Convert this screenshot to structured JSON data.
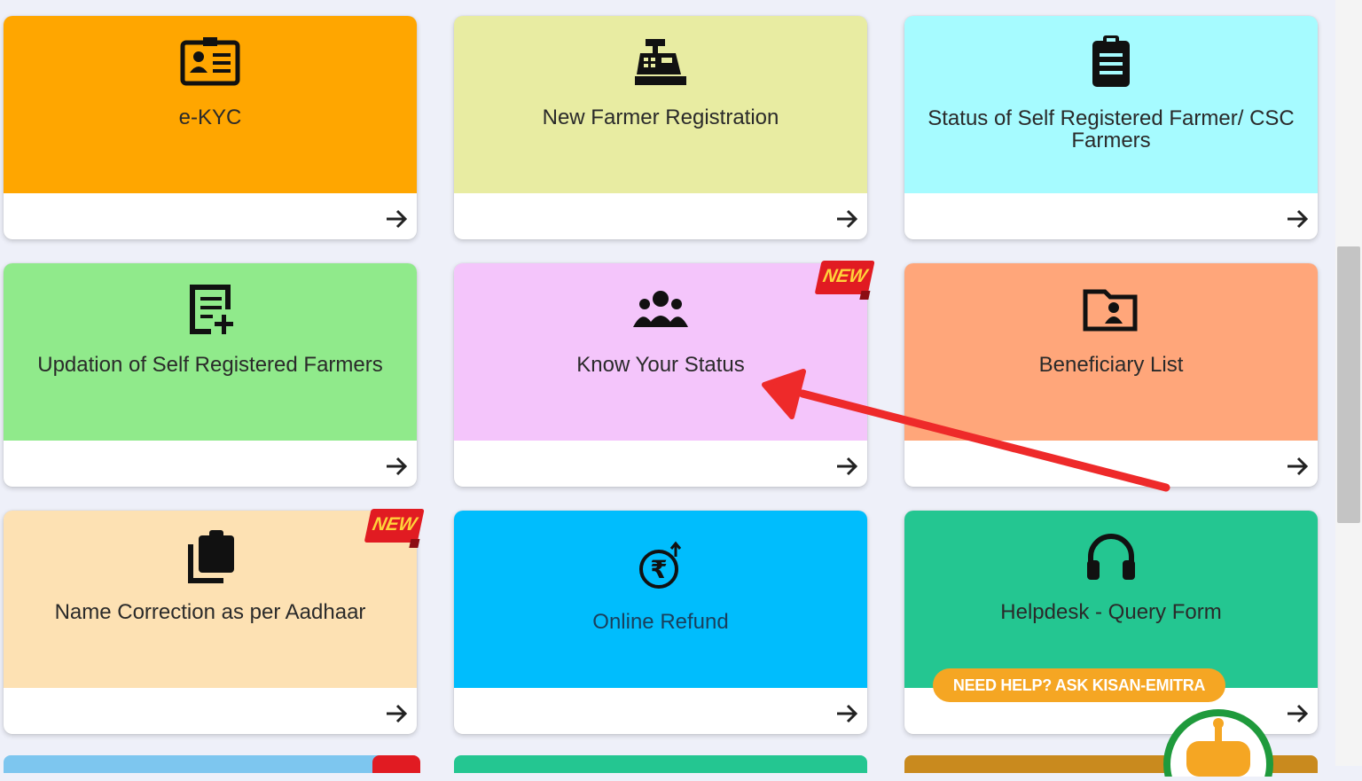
{
  "cards": [
    {
      "title": "e-KYC",
      "icon": "id-card-icon",
      "color": "#ffa600"
    },
    {
      "title": "New Farmer Registration",
      "icon": "cash-register-icon",
      "color": "#e8eca2"
    },
    {
      "title": "Status of Self Registered Farmer/ CSC Farmers",
      "icon": "clipboard-list-icon",
      "color": "#a6fbff"
    },
    {
      "title": "Updation of Self Registered Farmers",
      "icon": "edit-document-icon",
      "color": "#90ea8b"
    },
    {
      "title": "Know Your Status",
      "icon": "users-icon",
      "color": "#f4c5fb",
      "badge": "NEW"
    },
    {
      "title": "Beneficiary List",
      "icon": "folder-user-icon",
      "color": "#ffa67a"
    },
    {
      "title": "Name Correction as per Aadhaar",
      "icon": "clipboard-copy-icon",
      "color": "#fde1b3",
      "badge": "NEW"
    },
    {
      "title": "Online Refund",
      "icon": "rupee-refund-icon",
      "color": "#00bdfd"
    },
    {
      "title": "Helpdesk - Query Form",
      "icon": "headphones-icon",
      "color": "#24c691"
    }
  ],
  "help": {
    "label": "NEED HELP? ASK KISAN-EMITRA"
  },
  "annotation": {
    "arrow_color": "#ee2a2a"
  },
  "colors": {
    "page_bg": "#eef0f9",
    "badge_red": "#e11b22",
    "badge_text": "#ffd23a",
    "help_pill": "#f5a623"
  }
}
